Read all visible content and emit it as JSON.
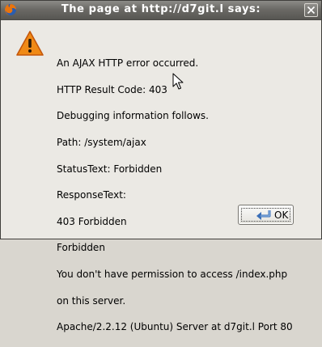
{
  "dialog": {
    "title": "The page at http://d7git.l says:",
    "app_icon": "firefox-icon",
    "close_icon": "close-icon",
    "warning_icon": "warning-triangle-icon",
    "message_lines": [
      "An AJAX HTTP error occurred.",
      "HTTP Result Code: 403",
      "Debugging information follows.",
      "Path: /system/ajax",
      "StatusText: Forbidden",
      "ResponseText:",
      "403 Forbidden",
      "Forbidden",
      "You don't have permission to access /index.php",
      "on this server.",
      "Apache/2.2.12 (Ubuntu) Server at d7git.l Port 80"
    ],
    "ok_label": "OK",
    "ok_icon": "ok-enter-icon",
    "accent": "#e8740e"
  }
}
